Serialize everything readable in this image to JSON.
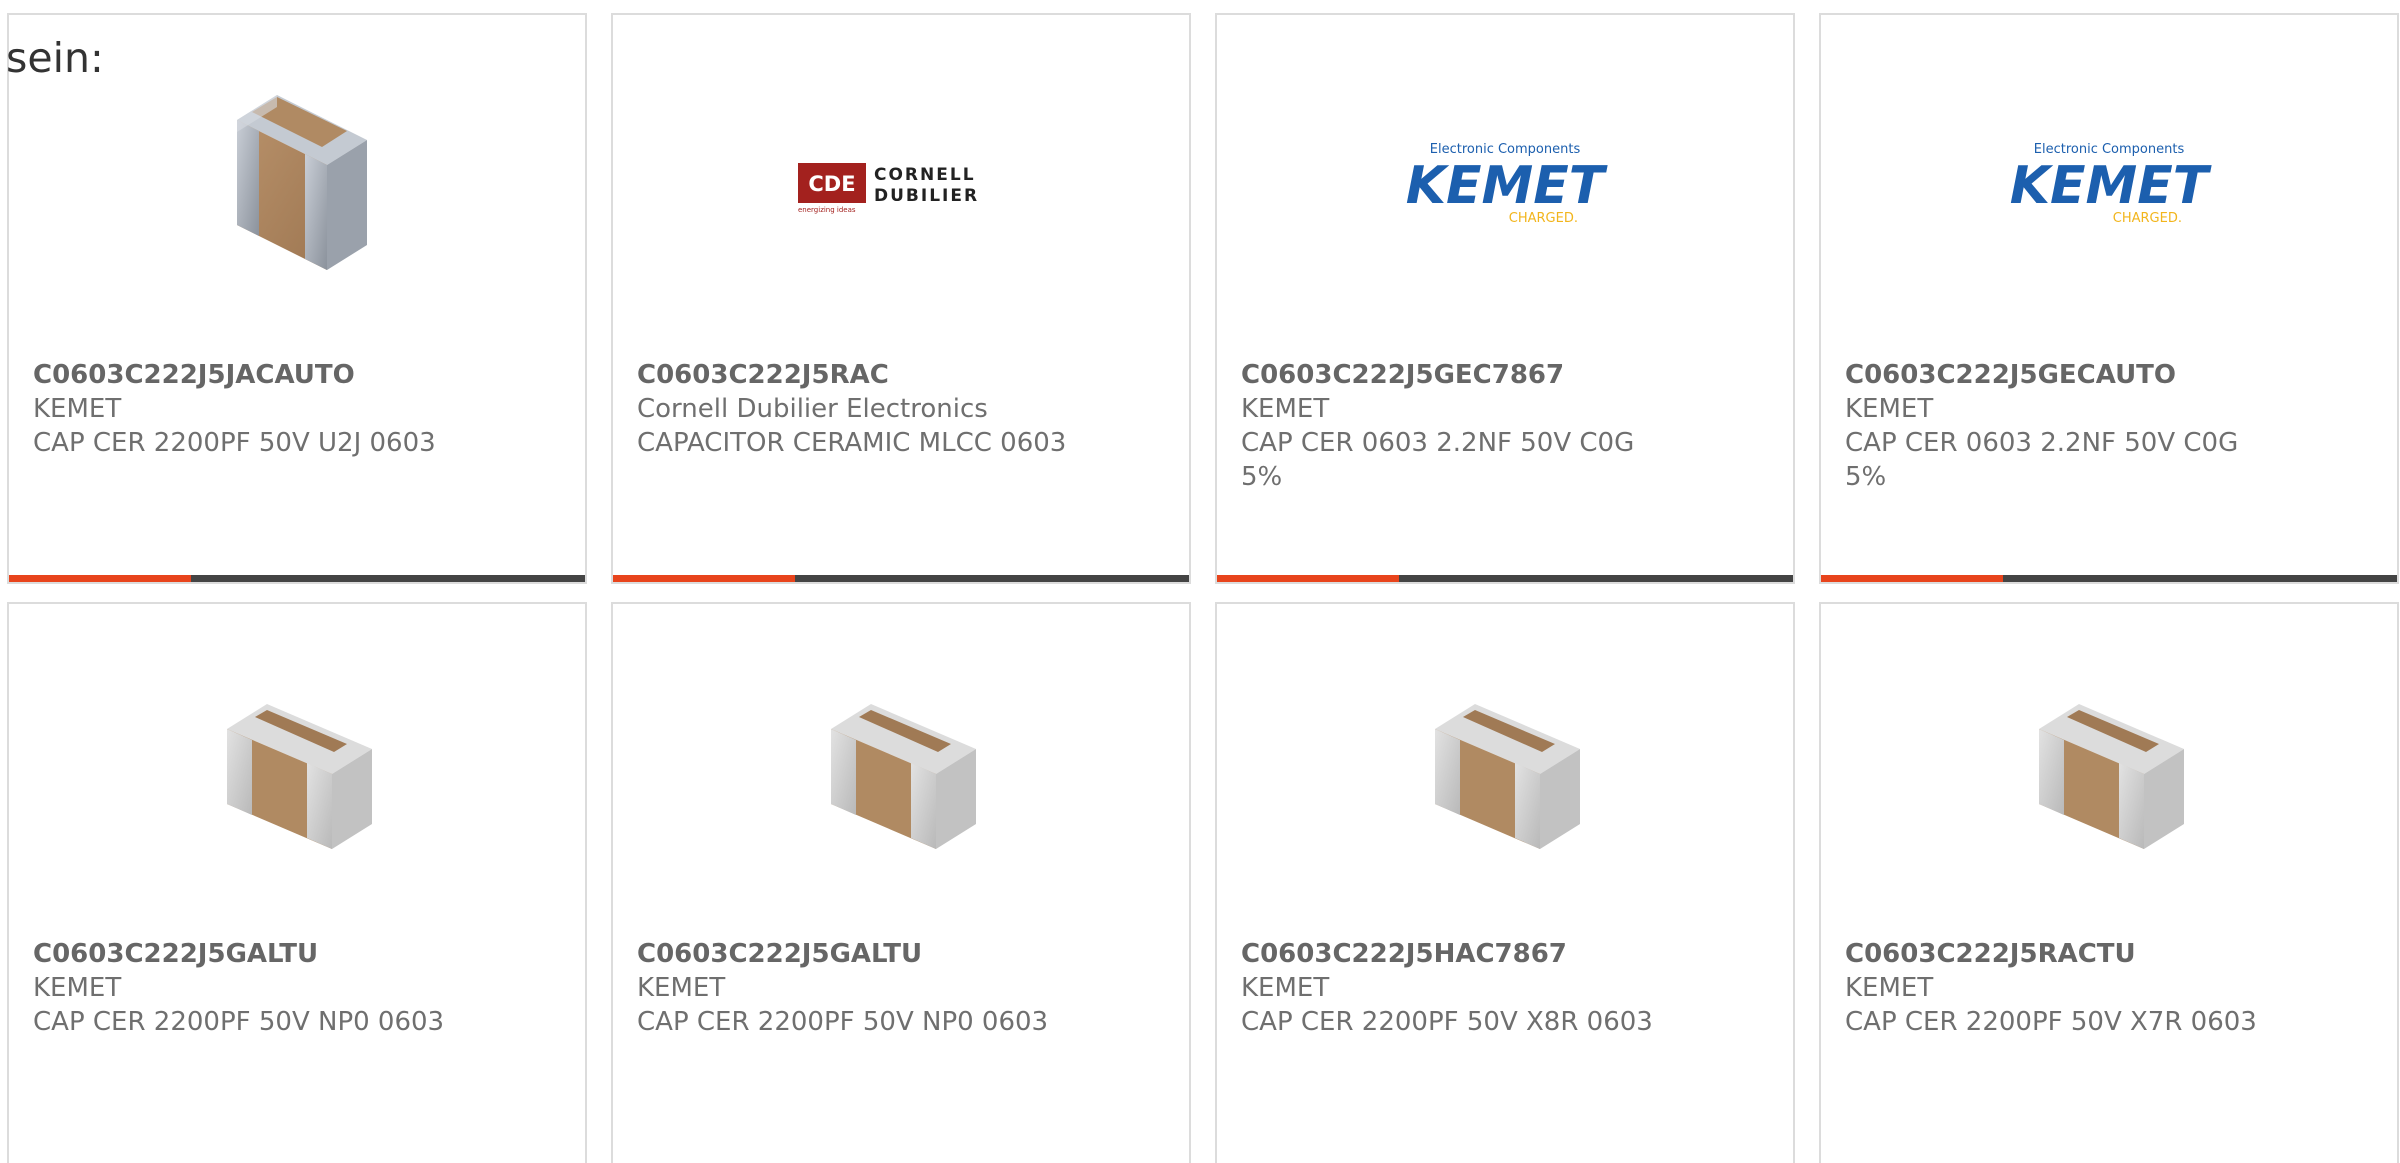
{
  "intro_text": "sein:",
  "colors": {
    "accent": "#e8441c",
    "bar_dark": "#444444",
    "card_border": "#dcdcdc",
    "text_gray": "#6f6f6f"
  },
  "products": [
    {
      "part_number": "C0603C222J5JACAUTO",
      "manufacturer": "KEMET",
      "description": "CAP CER 2200PF 50V U2J 0603",
      "image": "capacitor-chip-icon"
    },
    {
      "part_number": "C0603C222J5RAC",
      "manufacturer": "Cornell Dubilier Electronics",
      "description": "CAPACITOR CERAMIC MLCC 0603",
      "image": "cornell-dubilier-logo",
      "logo": {
        "badge": "CDE",
        "line1": "CORNELL",
        "line2": "DUBILIER",
        "tagline": "energizing ideas"
      }
    },
    {
      "part_number": "C0603C222J5GEC7867",
      "manufacturer": "KEMET",
      "description": "CAP CER 0603 2.2NF 50V C0G 5%",
      "image": "kemet-logo",
      "logo": {
        "top": "Electronic Components",
        "name": "KEMET",
        "bottom": "CHARGED."
      }
    },
    {
      "part_number": "C0603C222J5GECAUTO",
      "manufacturer": "KEMET",
      "description": "CAP CER 0603 2.2NF 50V C0G 5%",
      "image": "kemet-logo",
      "logo": {
        "top": "Electronic Components",
        "name": "KEMET",
        "bottom": "CHARGED."
      }
    },
    {
      "part_number": "C0603C222J5GALTU",
      "manufacturer": "KEMET",
      "description": "CAP CER 2200PF 50V NP0 0603",
      "image": "capacitor-chip-icon"
    },
    {
      "part_number": "C0603C222J5GALTU",
      "manufacturer": "KEMET",
      "description": "CAP CER 2200PF 50V NP0 0603",
      "image": "capacitor-chip-icon"
    },
    {
      "part_number": "C0603C222J5HAC7867",
      "manufacturer": "KEMET",
      "description": "CAP CER 2200PF 50V X8R 0603",
      "image": "capacitor-chip-icon"
    },
    {
      "part_number": "C0603C222J5RACTU",
      "manufacturer": "KEMET",
      "description": "CAP CER 2200PF 50V X7R 0603",
      "image": "capacitor-chip-icon"
    }
  ]
}
